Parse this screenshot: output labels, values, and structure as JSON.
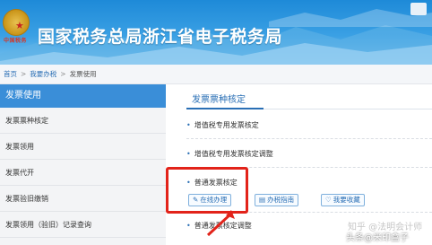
{
  "header": {
    "site_title": "国家税务总局浙江省电子税务局",
    "emblem_text": "中国税务",
    "colors": {
      "banner": "#1e8ad8",
      "accent": "#2a6fb5",
      "highlight": "#e2231a"
    }
  },
  "breadcrumb": {
    "home": "首页",
    "level1": "我要办税",
    "current": "发票使用"
  },
  "sidebar": {
    "heading": "发票使用",
    "items": [
      {
        "label": "发票票种核定"
      },
      {
        "label": "发票领用"
      },
      {
        "label": "发票代开"
      },
      {
        "label": "发票验旧缴销"
      },
      {
        "label": "发票领用（验旧）记录查询"
      }
    ]
  },
  "main": {
    "section_title": "发票票种核定",
    "items": [
      {
        "label": "增值税专用发票核定"
      },
      {
        "label": "增值税专用发票核定调整"
      },
      {
        "label": "普通发票核定"
      },
      {
        "label": "普通发票核定调整"
      }
    ],
    "buttons": {
      "online": {
        "label": "在线办理",
        "icon": "pencil-icon"
      },
      "guide": {
        "label": "办税指南",
        "icon": "book-icon"
      },
      "favorite": {
        "label": "我要收藏",
        "icon": "heart-icon"
      }
    }
  },
  "watermarks": {
    "zhihu": "知乎 @法明会计师",
    "source": "头条@米印盒子"
  }
}
